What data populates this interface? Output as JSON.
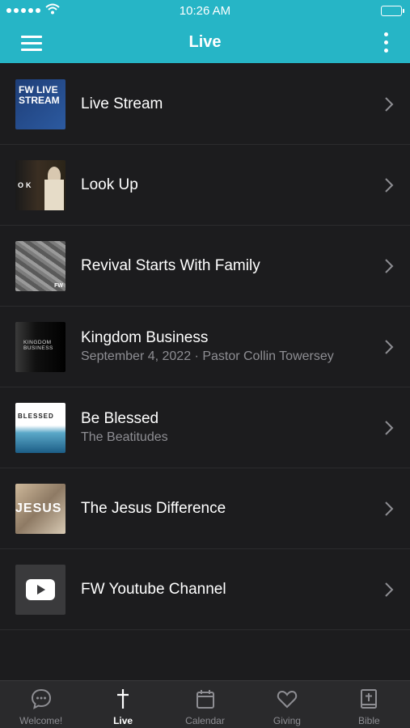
{
  "status_bar": {
    "time": "10:26 AM"
  },
  "header": {
    "title": "Live"
  },
  "items": [
    {
      "title": "Live Stream",
      "subtitle": "",
      "thumb_text": "FW LIVE STREAM"
    },
    {
      "title": "Look Up",
      "subtitle": "",
      "thumb_text": "OK"
    },
    {
      "title": "Revival Starts With Family",
      "subtitle": "",
      "thumb_text": "FW"
    },
    {
      "title": "Kingdom Business",
      "subtitle": "September 4, 2022 · Pastor Collin Towersey",
      "thumb_text": "KINGDOM BUSINESS"
    },
    {
      "title": "Be Blessed",
      "subtitle": "The Beatitudes",
      "thumb_text": "BLESSED"
    },
    {
      "title": "The Jesus Difference",
      "subtitle": "",
      "thumb_text": "JESUS"
    },
    {
      "title": "FW Youtube Channel",
      "subtitle": "",
      "thumb_text": ""
    }
  ],
  "tabs": [
    {
      "label": "Welcome!",
      "icon": "chat-bubble-icon"
    },
    {
      "label": "Live",
      "icon": "cross-icon"
    },
    {
      "label": "Calendar",
      "icon": "calendar-icon"
    },
    {
      "label": "Giving",
      "icon": "heart-icon"
    },
    {
      "label": "Bible",
      "icon": "bible-icon"
    }
  ],
  "colors": {
    "accent": "#26b5c6",
    "background": "#1c1c1e",
    "tabbar": "#2a2a2c",
    "secondary_text": "#8e8e93"
  }
}
